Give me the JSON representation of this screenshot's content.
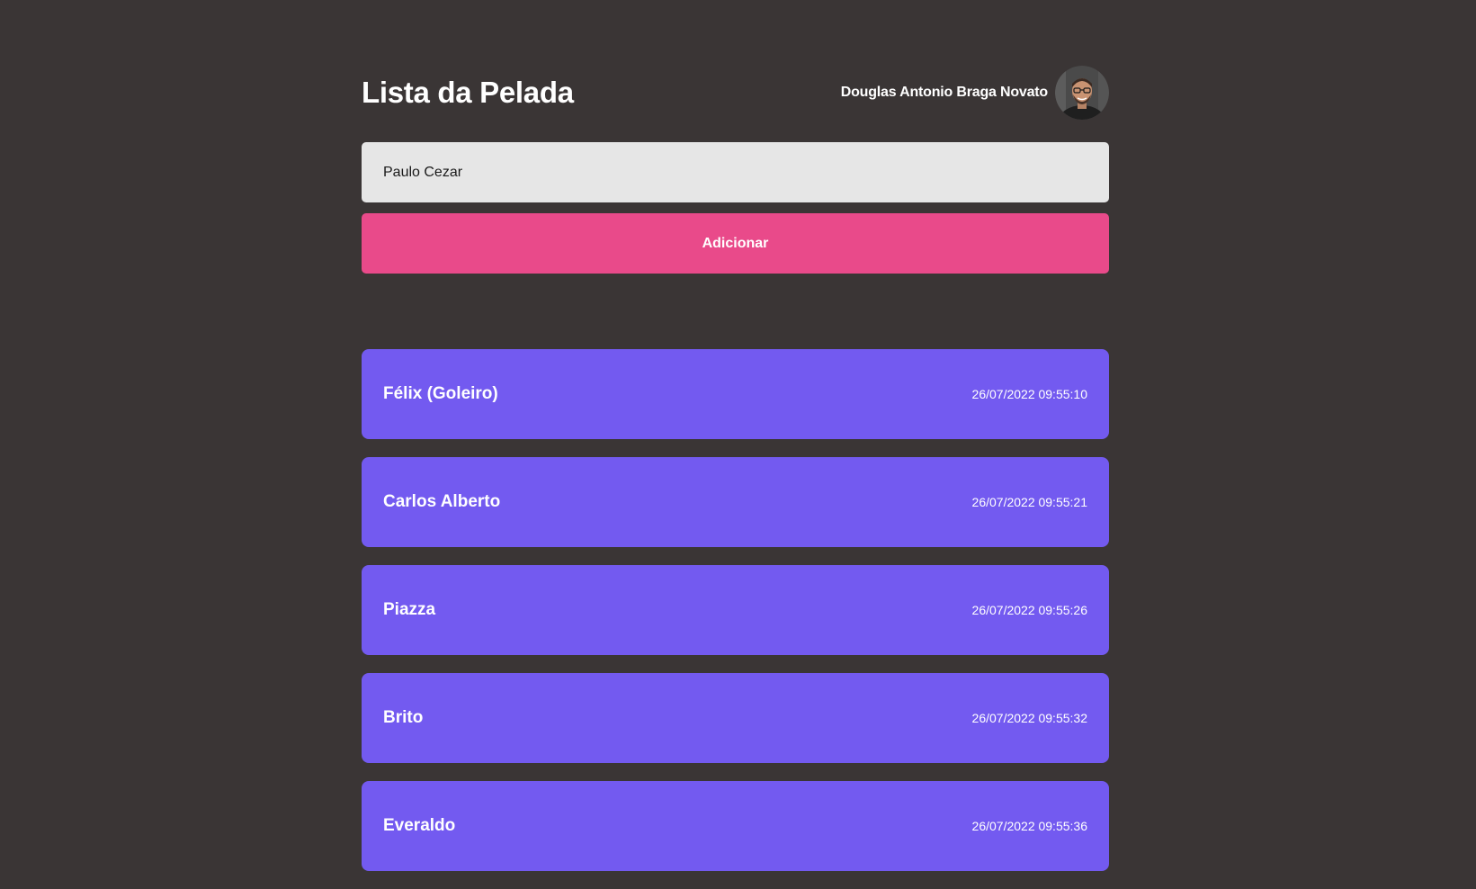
{
  "header": {
    "title": "Lista da Pelada",
    "user_name": "Douglas Antonio Braga Novato"
  },
  "form": {
    "input_value": "Paulo Cezar",
    "add_label": "Adicionar"
  },
  "players": [
    {
      "name": "Félix (Goleiro)",
      "time": "26/07/2022 09:55:10"
    },
    {
      "name": "Carlos Alberto",
      "time": "26/07/2022 09:55:21"
    },
    {
      "name": "Piazza",
      "time": "26/07/2022 09:55:26"
    },
    {
      "name": "Brito",
      "time": "26/07/2022 09:55:32"
    },
    {
      "name": "Everaldo",
      "time": "26/07/2022 09:55:36"
    }
  ],
  "colors": {
    "background": "#3a3535",
    "input_background": "#e6e6e6",
    "button": "#e94a8a",
    "card": "#735af0"
  }
}
